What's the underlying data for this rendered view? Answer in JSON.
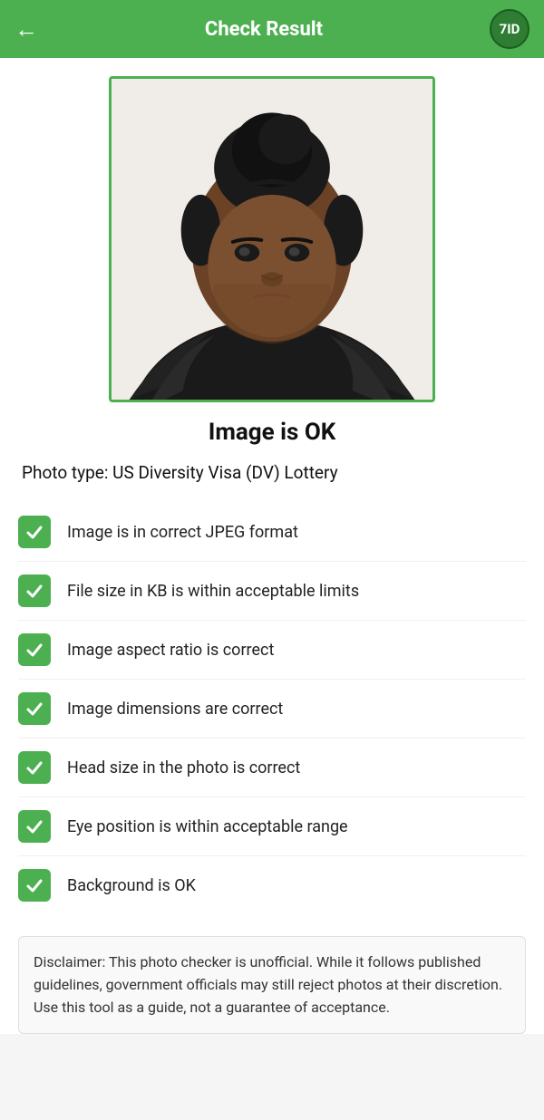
{
  "header": {
    "back_icon": "←",
    "title": "Check Result",
    "logo_text": "7ID"
  },
  "status": {
    "label": "Image is OK"
  },
  "photo_type": {
    "label": "Photo type: US Diversity Visa (DV) Lottery"
  },
  "checks": [
    {
      "id": "jpeg",
      "text": "Image is in correct JPEG format",
      "passed": true
    },
    {
      "id": "filesize",
      "text": "File size in KB is within acceptable limits",
      "passed": true
    },
    {
      "id": "aspect",
      "text": "Image aspect ratio is correct",
      "passed": true
    },
    {
      "id": "dimensions",
      "text": "Image dimensions are correct",
      "passed": true
    },
    {
      "id": "head",
      "text": "Head size in the photo is correct",
      "passed": true
    },
    {
      "id": "eyes",
      "text": "Eye position is within acceptable range",
      "passed": true
    },
    {
      "id": "background",
      "text": "Background is OK",
      "passed": true
    }
  ],
  "disclaimer": {
    "text": "Disclaimer: This photo checker is unofficial. While it follows published guidelines, government officials may still reject photos at their discretion. Use this tool as a guide, not a guarantee of acceptance."
  }
}
